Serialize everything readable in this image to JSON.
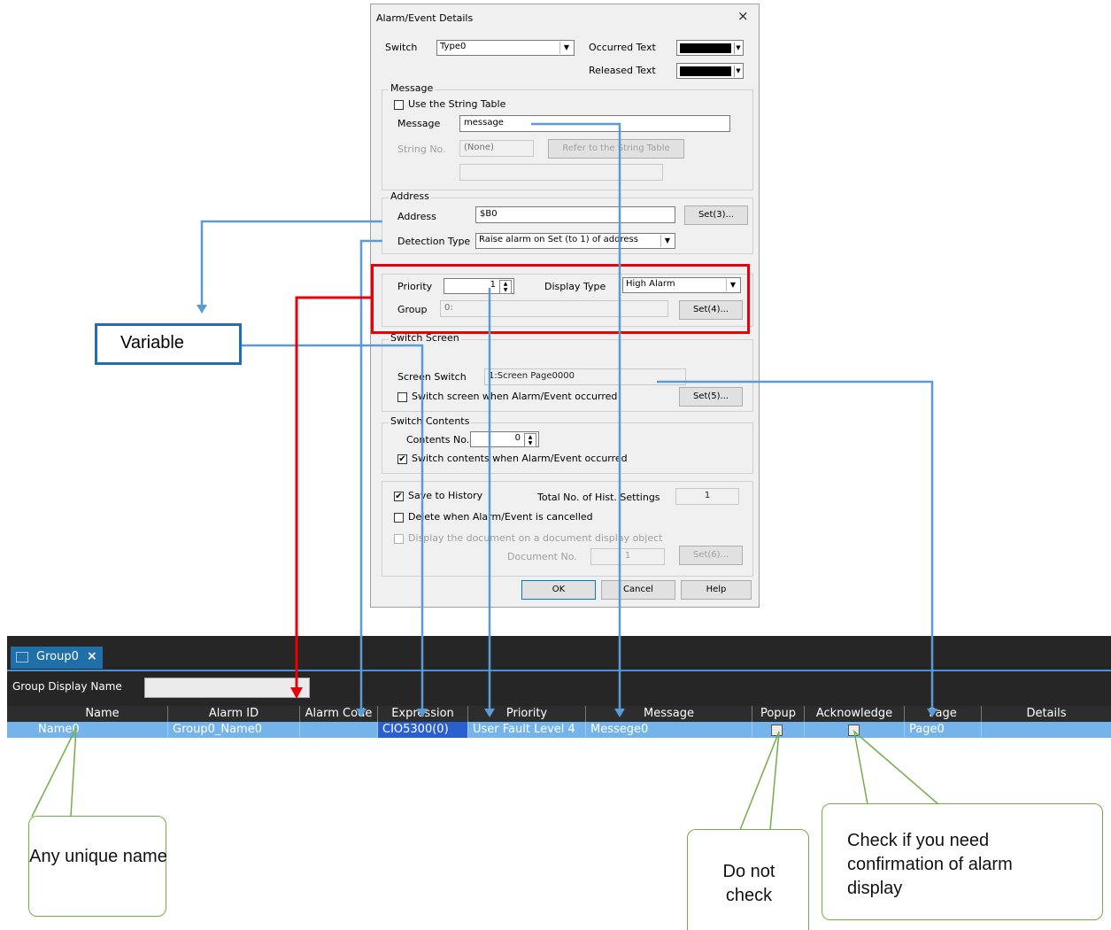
{
  "dialog": {
    "title": "Alarm/Event Details",
    "close": "×",
    "switch_label": "Switch",
    "switch_value": "Type0",
    "occurred_text_label": "Occurred Text",
    "released_text_label": "Released Text",
    "message_group": {
      "title": "Message",
      "use_string_table": "Use the String Table",
      "message_label": "Message",
      "message_value": "message",
      "string_no_label": "String No.",
      "string_no_value": "(None)",
      "refer_button": "Refer to the String Table"
    },
    "address_group": {
      "title": "Address",
      "address_label": "Address",
      "address_value": "$B0",
      "set_button": "Set(3)...",
      "detection_label": "Detection Type",
      "detection_value": "Raise alarm on Set (to 1) of address"
    },
    "priority_group": {
      "priority_label": "Priority",
      "priority_value": "1",
      "display_type_label": "Display Type",
      "display_type_value": "High Alarm",
      "group_label": "Group",
      "group_value": "0:",
      "set_button": "Set(4)..."
    },
    "switch_screen": {
      "title": "Switch Screen",
      "screen_switch_label": "Screen Switch",
      "screen_switch_value": "1:Screen Page0000",
      "checkbox_label": "Switch screen when Alarm/Event occurred",
      "set_button": "Set(5)..."
    },
    "switch_contents": {
      "title": "Switch Contents",
      "contents_no_label": "Contents No.",
      "contents_no_value": "0",
      "checkbox_label": "Switch contents when Alarm/Event occurred"
    },
    "history": {
      "save_label": "Save to History",
      "total_label": "Total No. of Hist. Settings",
      "total_value": "1",
      "delete_label": "Delete when Alarm/Event is cancelled",
      "display_doc_label": "Display the document on a document display object",
      "doc_no_label": "Document No.",
      "doc_no_value": "1",
      "set_button": "Set(6)..."
    },
    "ok": "OK",
    "cancel": "Cancel",
    "help": "Help"
  },
  "table": {
    "tab": "Group0",
    "tab_close": "×",
    "group_display_name_label": "Group Display Name",
    "columns": [
      "Name",
      "Alarm ID",
      "Alarm Code",
      "Expression",
      "Priority",
      "Message",
      "Popup",
      "Acknowledge",
      "Page",
      "Details"
    ],
    "row": {
      "name": "Name0",
      "alarm_id": "Group0_Name0",
      "alarm_code": "",
      "expression": "CIO5300(0)",
      "priority": "User Fault Level 4",
      "message": "Messege0",
      "page": "Page0",
      "details": ""
    }
  },
  "annotations": {
    "variable": "Variable",
    "unique_name": "Any unique name",
    "do_not_check": "Do not check",
    "acknowledge_note": "Check if you need confirmation of alarm display"
  },
  "colors": {
    "highlight_red": "#e8000b",
    "arrow_blue": "#5b9bd5",
    "callout_green": "#72ae47",
    "variable_border": "#1f6fb2"
  }
}
